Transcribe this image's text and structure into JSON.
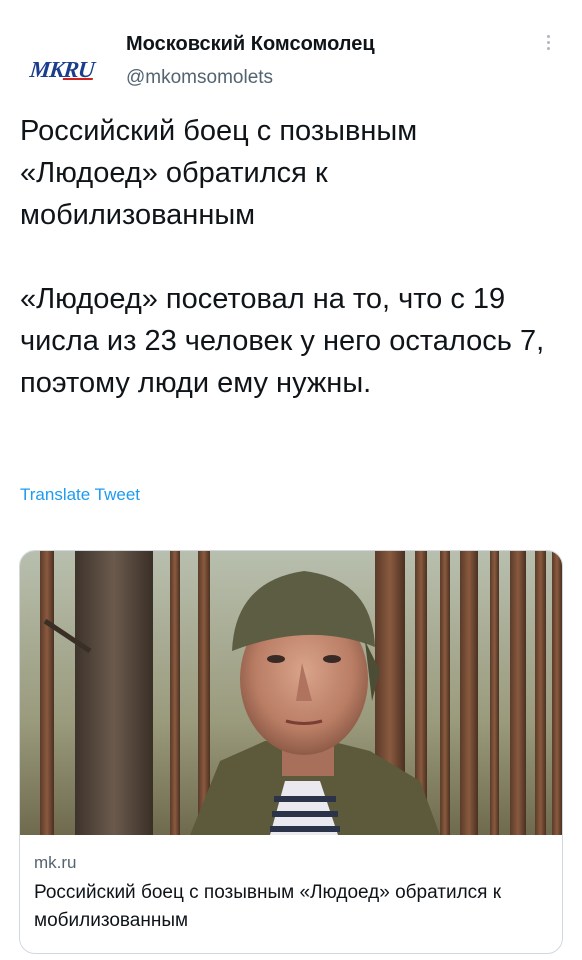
{
  "author": {
    "logo_text_a": "MK",
    "logo_text_b": "RU",
    "name": "Московский Комсомолец",
    "handle": "@mkomsomolets"
  },
  "tweet": {
    "text": "Российский боец с позывным «Людоед» обратился к мобилизованным\n\n«Людоед» посетовал на то, что с 19 числа из 23 человек у него осталось 7, поэтому люди ему нужны.",
    "translate_label": "Translate Tweet"
  },
  "card": {
    "domain": "mk.ru",
    "title": "Российский боец с позывным «Людоед» обратился к мобилизованным"
  },
  "colors": {
    "link": "#1d9bf0",
    "secondary_text": "#536471",
    "logo_blue": "#1a3d8c",
    "logo_red": "#d0201b"
  }
}
